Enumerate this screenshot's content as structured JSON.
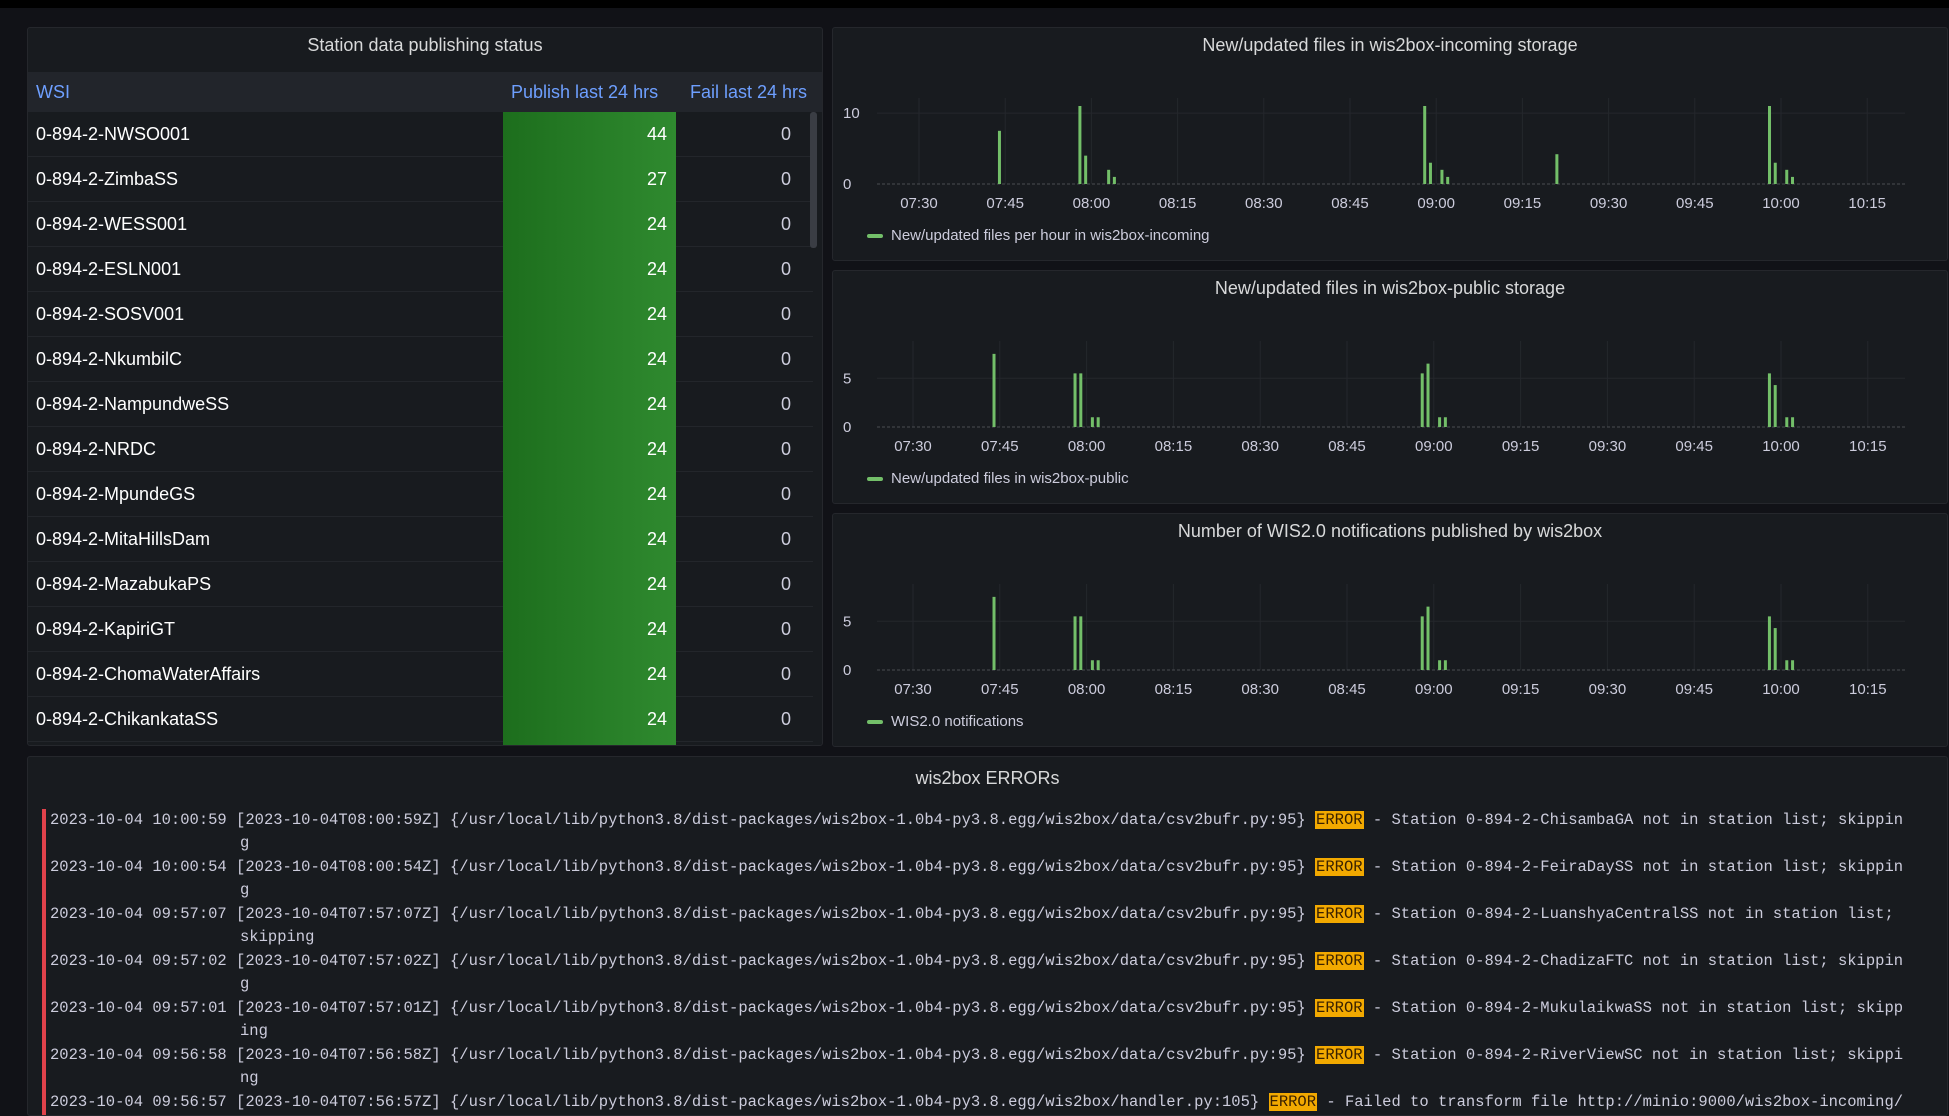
{
  "station_panel": {
    "title": "Station data publishing status",
    "columns": [
      "WSI",
      "Publish last 24 hrs",
      "Fail last 24 hrs"
    ],
    "rows": [
      {
        "wsi": "0-894-2-NWSO001",
        "publish": "44",
        "fail": "0"
      },
      {
        "wsi": "0-894-2-ZimbaSS",
        "publish": "27",
        "fail": "0"
      },
      {
        "wsi": "0-894-2-WESS001",
        "publish": "24",
        "fail": "0"
      },
      {
        "wsi": "0-894-2-ESLN001",
        "publish": "24",
        "fail": "0"
      },
      {
        "wsi": "0-894-2-SOSV001",
        "publish": "24",
        "fail": "0"
      },
      {
        "wsi": "0-894-2-NkumbilC",
        "publish": "24",
        "fail": "0"
      },
      {
        "wsi": "0-894-2-NampundweSS",
        "publish": "24",
        "fail": "0"
      },
      {
        "wsi": "0-894-2-NRDC",
        "publish": "24",
        "fail": "0"
      },
      {
        "wsi": "0-894-2-MpundeGS",
        "publish": "24",
        "fail": "0"
      },
      {
        "wsi": "0-894-2-MitaHillsDam",
        "publish": "24",
        "fail": "0"
      },
      {
        "wsi": "0-894-2-MazabukaPS",
        "publish": "24",
        "fail": "0"
      },
      {
        "wsi": "0-894-2-KapiriGT",
        "publish": "24",
        "fail": "0"
      },
      {
        "wsi": "0-894-2-ChomaWaterAffairs",
        "publish": "24",
        "fail": "0"
      },
      {
        "wsi": "0-894-2-ChikankataSS",
        "publish": "24",
        "fail": "0"
      }
    ]
  },
  "colors": {
    "series": "#73bf69",
    "publish_cell": "#2f8a2f",
    "error_badge": "#f2a900",
    "accent_header": "#6e9fff"
  },
  "chart_data": [
    {
      "type": "bar",
      "title": "New/updated files in wis2box-incoming storage",
      "x_ticks": [
        "07:30",
        "07:45",
        "08:00",
        "08:15",
        "08:30",
        "08:45",
        "09:00",
        "09:15",
        "09:30",
        "09:45",
        "10:00",
        "10:15"
      ],
      "y_ticks": [
        "10",
        "0"
      ],
      "ylim": [
        0,
        11
      ],
      "series": [
        {
          "name": "New/updated files per hour in wis2box-incoming",
          "points": [
            [
              "07:44",
              7.5
            ],
            [
              "07:58",
              11
            ],
            [
              "07:59",
              4
            ],
            [
              "08:03",
              2
            ],
            [
              "08:04",
              1
            ],
            [
              "08:58",
              11
            ],
            [
              "08:59",
              3
            ],
            [
              "09:01",
              2
            ],
            [
              "09:02",
              1
            ],
            [
              "09:21",
              4.2
            ],
            [
              "09:58",
              11
            ],
            [
              "09:59",
              3
            ],
            [
              "10:01",
              2
            ],
            [
              "10:02",
              1
            ]
          ]
        }
      ]
    },
    {
      "type": "bar",
      "title": "New/updated files in wis2box-public storage",
      "x_ticks": [
        "07:30",
        "07:45",
        "08:00",
        "08:15",
        "08:30",
        "08:45",
        "09:00",
        "09:15",
        "09:30",
        "09:45",
        "10:00",
        "10:15"
      ],
      "y_ticks": [
        "5",
        "0"
      ],
      "ylim": [
        0,
        8
      ],
      "series": [
        {
          "name": "New/updated files in wis2box-public",
          "points": [
            [
              "07:44",
              7.5
            ],
            [
              "07:58",
              5.5
            ],
            [
              "07:59",
              5.5
            ],
            [
              "08:01",
              1
            ],
            [
              "08:02",
              1
            ],
            [
              "08:58",
              5.5
            ],
            [
              "08:59",
              6.5
            ],
            [
              "09:01",
              1
            ],
            [
              "09:02",
              1
            ],
            [
              "09:58",
              5.5
            ],
            [
              "09:59",
              4.3
            ],
            [
              "10:01",
              1
            ],
            [
              "10:02",
              1
            ]
          ]
        }
      ]
    },
    {
      "type": "bar",
      "title": "Number of WIS2.0 notifications published by wis2box",
      "x_ticks": [
        "07:30",
        "07:45",
        "08:00",
        "08:15",
        "08:30",
        "08:45",
        "09:00",
        "09:15",
        "09:30",
        "09:45",
        "10:00",
        "10:15"
      ],
      "y_ticks": [
        "5",
        "0"
      ],
      "ylim": [
        0,
        8
      ],
      "series": [
        {
          "name": "WIS2.0 notifications",
          "points": [
            [
              "07:44",
              7.5
            ],
            [
              "07:58",
              5.5
            ],
            [
              "07:59",
              5.5
            ],
            [
              "08:01",
              1
            ],
            [
              "08:02",
              1
            ],
            [
              "08:58",
              5.5
            ],
            [
              "08:59",
              6.5
            ],
            [
              "09:01",
              1
            ],
            [
              "09:02",
              1
            ],
            [
              "09:58",
              5.5
            ],
            [
              "09:59",
              4.3
            ],
            [
              "10:01",
              1
            ],
            [
              "10:02",
              1
            ]
          ]
        }
      ]
    }
  ],
  "errors_panel": {
    "title": "wis2box ERRORs",
    "entries": [
      {
        "ts": "2023-10-04 10:00:59",
        "before": "[2023-10-04T08:00:59Z] {/usr/local/lib/python3.8/dist-packages/wis2box-1.0b4-py3.8.egg/wis2box/data/csv2bufr.py:95}",
        "level": "ERROR",
        "after": " - Station 0-894-2-ChisambaGA not in station list; skippin",
        "cont": "g"
      },
      {
        "ts": "2023-10-04 10:00:54",
        "before": "[2023-10-04T08:00:54Z] {/usr/local/lib/python3.8/dist-packages/wis2box-1.0b4-py3.8.egg/wis2box/data/csv2bufr.py:95}",
        "level": "ERROR",
        "after": " - Station 0-894-2-FeiraDaySS not in station list; skippin",
        "cont": "g"
      },
      {
        "ts": "2023-10-04 09:57:07",
        "before": "[2023-10-04T07:57:07Z] {/usr/local/lib/python3.8/dist-packages/wis2box-1.0b4-py3.8.egg/wis2box/data/csv2bufr.py:95}",
        "level": "ERROR",
        "after": " - Station 0-894-2-LuanshyaCentralSS not in station list;",
        "cont": "skipping"
      },
      {
        "ts": "2023-10-04 09:57:02",
        "before": "[2023-10-04T07:57:02Z] {/usr/local/lib/python3.8/dist-packages/wis2box-1.0b4-py3.8.egg/wis2box/data/csv2bufr.py:95}",
        "level": "ERROR",
        "after": " - Station 0-894-2-ChadizaFTC not in station list; skippin",
        "cont": "g"
      },
      {
        "ts": "2023-10-04 09:57:01",
        "before": "[2023-10-04T07:57:01Z] {/usr/local/lib/python3.8/dist-packages/wis2box-1.0b4-py3.8.egg/wis2box/data/csv2bufr.py:95}",
        "level": "ERROR",
        "after": " - Station 0-894-2-MukulaikwaSS not in station list; skipp",
        "cont": "ing"
      },
      {
        "ts": "2023-10-04 09:56:58",
        "before": "[2023-10-04T07:56:58Z] {/usr/local/lib/python3.8/dist-packages/wis2box-1.0b4-py3.8.egg/wis2box/data/csv2bufr.py:95}",
        "level": "ERROR",
        "after": " - Station 0-894-2-RiverViewSC not in station list; skippi",
        "cont": "ng"
      },
      {
        "ts": "2023-10-04 09:56:57",
        "before": "[2023-10-04T07:56:57Z] {/usr/local/lib/python3.8/dist-packages/wis2box-1.0b4-py3.8.egg/wis2box/handler.py:105}",
        "level": "ERROR",
        "after": " - Failed to transform file http://minio:9000/wis2box-incoming/",
        "cont": ""
      }
    ]
  }
}
